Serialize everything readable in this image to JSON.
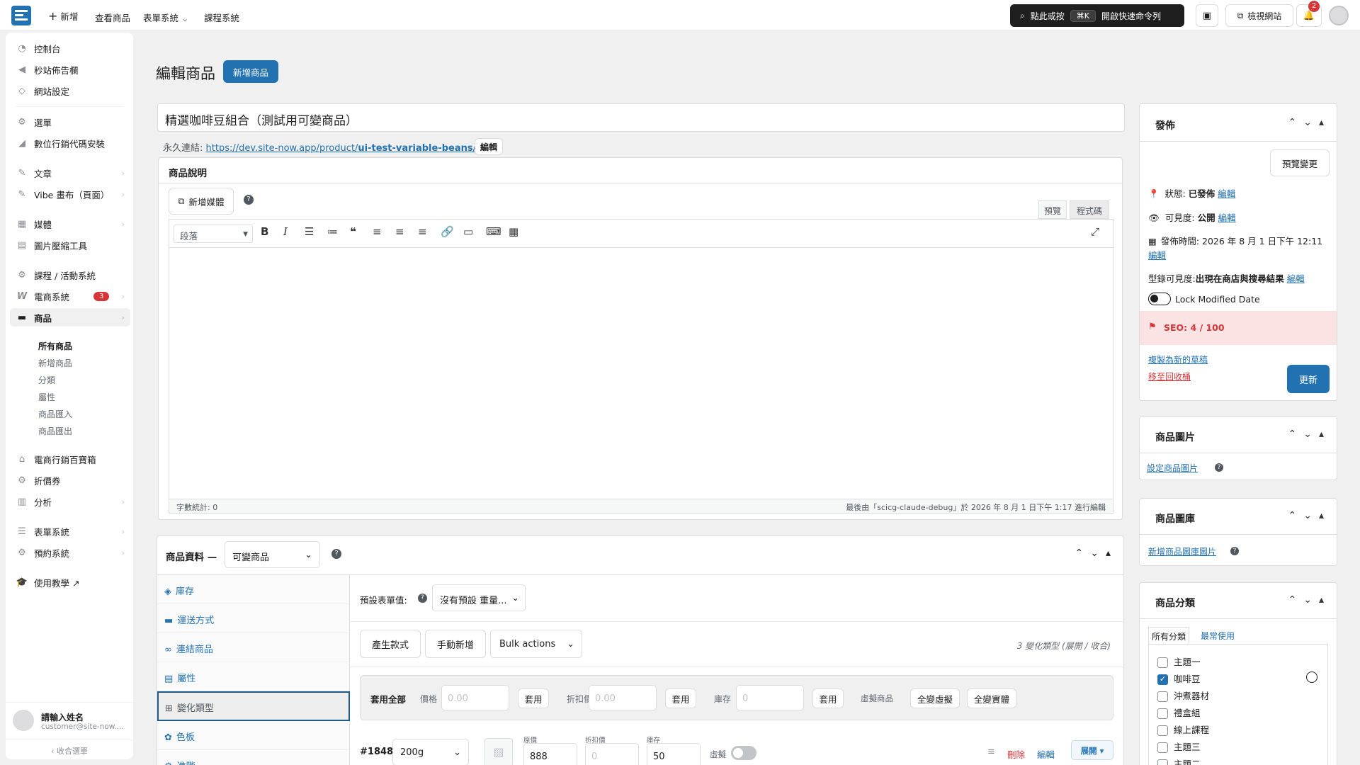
{
  "topbar": {
    "new_label": "新增",
    "view_products": "查看商品",
    "forms": "表單系統",
    "courses": "課程系統",
    "search_hint": "點此或按",
    "shortcut": "⌘K",
    "quick_cmd": "開啟快速命令列",
    "view_site": "檢視網站",
    "notif_count": "2"
  },
  "sidebar": {
    "items": [
      {
        "icon": "dashboard-icon",
        "label": "控制台"
      },
      {
        "icon": "megaphone-icon",
        "label": "秒站佈告欄"
      },
      {
        "icon": "diamond-icon",
        "label": "網站設定"
      },
      {
        "icon": "gear-icon",
        "label": "選單"
      },
      {
        "icon": "chart-icon",
        "label": "數位行銷代碼安裝"
      },
      {
        "icon": "pin-icon",
        "label": "文章"
      },
      {
        "icon": "pin-icon",
        "label": "Vibe 畫布（頁面）"
      },
      {
        "icon": "media-icon",
        "label": "媒體"
      },
      {
        "icon": "image-compress-icon",
        "label": "圖片壓縮工具"
      },
      {
        "icon": "gear-icon",
        "label": "課程 / 活動系統"
      },
      {
        "icon": "woo-icon",
        "label": "電商系統",
        "badge": "3"
      },
      {
        "icon": "box-icon",
        "label": "商品"
      },
      {
        "icon": "store-icon",
        "label": "電商行銷百寶箱"
      },
      {
        "icon": "gear-icon",
        "label": "折價券"
      },
      {
        "icon": "bar-chart-icon",
        "label": "分析"
      },
      {
        "icon": "form-icon",
        "label": "表單系統"
      },
      {
        "icon": "gear-icon",
        "label": "預約系統"
      },
      {
        "icon": "grad-cap-icon",
        "label": "使用教學 ↗"
      }
    ],
    "sub_items": [
      "所有商品",
      "新增商品",
      "分類",
      "屬性",
      "商品匯入",
      "商品匯出"
    ],
    "user_name": "請輸入姓名",
    "user_email": "customer@site-now....",
    "collapse": "收合選單"
  },
  "page": {
    "title": "編輯商品",
    "add_new": "新增商品",
    "product_title": "精選咖啡豆組合（測試用可變商品）",
    "permalink_label": "永久連結:",
    "permalink_base": "https://dev.site-now.app/product/",
    "permalink_slug": "ui-test-variable-beans",
    "permalink_end": "/",
    "edit": "編輯"
  },
  "editor": {
    "header": "商品說明",
    "add_media": "新增媒體",
    "tab_visual": "預覽",
    "tab_code": "程式碼",
    "format": "段落",
    "word_count": "字數統計: 0",
    "last_edit": "最後由「scicg-claude-debug」於 2026 年 8 月 1 日下午 1:17 進行編輯"
  },
  "product_data": {
    "label": "商品資料 —",
    "type": "可變商品",
    "tabs": [
      "庫存",
      "運送方式",
      "連結商品",
      "屬性",
      "變化類型",
      "色板",
      "進階"
    ],
    "tab_icons": [
      "tag-icon",
      "truck-icon",
      "link-icon",
      "list-icon",
      "grid-icon",
      "palette-icon",
      "gear-icon"
    ],
    "default_form": "預設表單值:",
    "default_select": "沒有預設 重量...",
    "generate": "產生款式",
    "manual_add": "手動新增",
    "bulk": "Bulk actions",
    "count_text": "3 變化類型 (展開 / 收合)",
    "apply_all": "套用全部",
    "price": "價格",
    "sale": "折扣價",
    "stock": "庫存",
    "placeholder_price": "0.00",
    "placeholder_stock": "0",
    "apply": "套用",
    "virtual": "虛擬商品",
    "all_virtual": "全變虛擬",
    "all_physical": "全變實體",
    "var_id": "#1848",
    "var_weight": "200g",
    "orig_label": "原價",
    "orig_val": "888",
    "disc_label": "折扣價",
    "disc_ph": "0",
    "stock_label": "庫存",
    "stock_val": "50",
    "virtual_label": "虛擬",
    "delete": "刪除",
    "expand": "展開 ▾"
  },
  "publish": {
    "title": "發佈",
    "preview": "預覽變更",
    "status_label": "狀態:",
    "status": "已發佈",
    "visibility_label": "可見度:",
    "visibility": "公開",
    "date_label": "發佈時間:",
    "date": "2026 年 8 月 1 日下午 12:11",
    "catalog_label": "型錄可見度:",
    "catalog": "出現在商店與搜尋結果",
    "lock": "Lock Modified Date",
    "seo": "SEO: 4 / 100",
    "copy": "複製為新的草稿",
    "trash": "移至回收桶",
    "update": "更新"
  },
  "product_image": {
    "title": "商品圖片",
    "link": "設定商品圖片"
  },
  "gallery": {
    "title": "商品圖庫",
    "link": "新增商品圖庫圖片"
  },
  "categories": {
    "title": "商品分類",
    "tab_all": "所有分類",
    "tab_common": "最常使用",
    "items": [
      {
        "label": "主題一",
        "checked": false
      },
      {
        "label": "咖啡豆",
        "checked": true
      },
      {
        "label": "沖煮器材",
        "checked": false
      },
      {
        "label": "禮盒組",
        "checked": false
      },
      {
        "label": "線上課程",
        "checked": false
      },
      {
        "label": "主題三",
        "checked": false
      },
      {
        "label": "主題二",
        "checked": false
      }
    ]
  }
}
